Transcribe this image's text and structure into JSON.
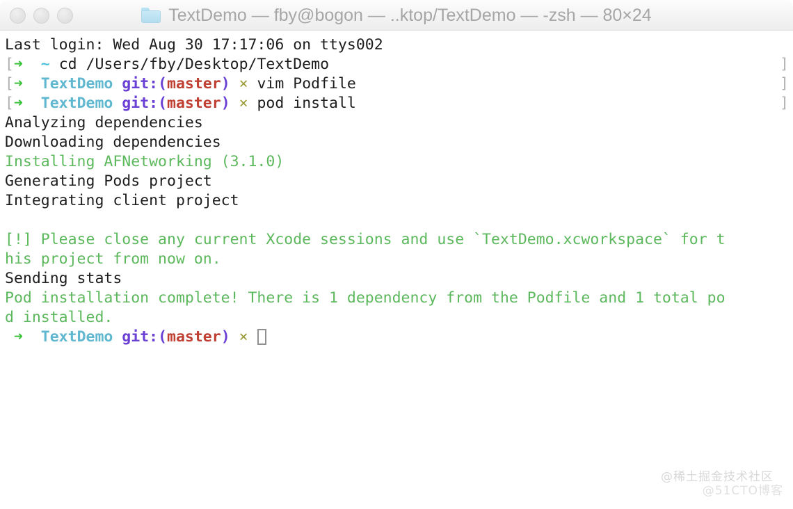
{
  "window": {
    "title": "TextDemo — fby@bogon — ..ktop/TextDemo — -zsh — 80×24",
    "folder_icon": "folder-icon",
    "traffic_lights": [
      {
        "name": "close-button",
        "color": "#e4e4e4"
      },
      {
        "name": "minimize-button",
        "color": "#e4e4e4"
      },
      {
        "name": "zoom-button",
        "color": "#e4e4e4"
      }
    ],
    "colors": {
      "titlebar_bg": "#f3f3f3",
      "title_text": "#a6a6a6",
      "terminal_bg": "#ffffff",
      "terminal_fg": "#1d1d1d",
      "prompt_arrow": "#3fc13f",
      "prompt_path": "#5fb8cf",
      "prompt_git": "#6a3fd4",
      "prompt_branch": "#bf3f33",
      "prompt_dirty": "#9a9a35",
      "output_green": "#5cb85c",
      "bracket_gray": "#b0b0b0",
      "folder_blue": "#b4ddef"
    }
  },
  "terminal": {
    "lines": [
      {
        "type": "plain",
        "text": "Last login: Wed Aug 30 17:17:06 on ttys002"
      },
      {
        "type": "prompt",
        "bracket_left": "[",
        "arrow": "➜",
        "gap": "  ",
        "path": "~",
        "git": "",
        "branch": "",
        "dirty": "",
        "command": " cd /Users/fby/Desktop/TextDemo",
        "bracket_right": "]"
      },
      {
        "type": "prompt",
        "bracket_left": "[",
        "arrow": "➜",
        "gap": "  ",
        "path": "TextDemo",
        "git": " git:(",
        "branch": "master",
        "git_close": ")",
        "dirty": " ×",
        "command": " vim Podfile",
        "bracket_right": "]"
      },
      {
        "type": "prompt",
        "bracket_left": "[",
        "arrow": "➜",
        "gap": "  ",
        "path": "TextDemo",
        "git": " git:(",
        "branch": "master",
        "git_close": ")",
        "dirty": " ×",
        "command": " pod install",
        "bracket_right": "]"
      },
      {
        "type": "plain",
        "text": "Analyzing dependencies"
      },
      {
        "type": "plain",
        "text": "Downloading dependencies"
      },
      {
        "type": "green",
        "text": "Installing AFNetworking (3.1.0)"
      },
      {
        "type": "plain",
        "text": "Generating Pods project"
      },
      {
        "type": "plain",
        "text": "Integrating client project"
      },
      {
        "type": "blank",
        "text": " "
      },
      {
        "type": "green",
        "text": "[!] Please close any current Xcode sessions and use `TextDemo.xcworkspace` for t"
      },
      {
        "type": "green",
        "text": "his project from now on."
      },
      {
        "type": "plain",
        "text": "Sending stats"
      },
      {
        "type": "green",
        "text": "Pod installation complete! There is 1 dependency from the Podfile and 1 total po"
      },
      {
        "type": "green",
        "text": "d installed."
      },
      {
        "type": "prompt",
        "bracket_left": " ",
        "arrow": "➜",
        "gap": "  ",
        "path": "TextDemo",
        "git": " git:(",
        "branch": "master",
        "git_close": ")",
        "dirty": " ×",
        "command": " ",
        "bracket_right": "",
        "cursor": true
      }
    ]
  },
  "watermarks": {
    "juejin": "@稀土掘金技术社区",
    "cto51": "@51CTO博客"
  }
}
